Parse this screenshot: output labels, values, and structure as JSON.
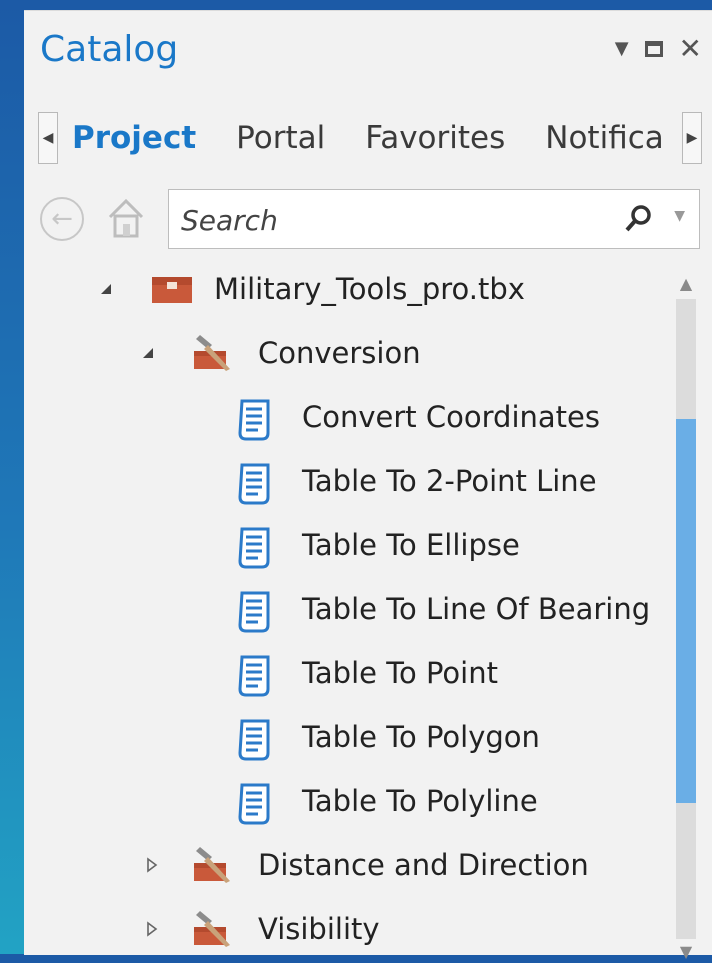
{
  "panel": {
    "title": "Catalog"
  },
  "tabs": [
    {
      "label": "Project",
      "active": true
    },
    {
      "label": "Portal",
      "active": false
    },
    {
      "label": "Favorites",
      "active": false
    },
    {
      "label": "Notifica",
      "active": false
    }
  ],
  "search": {
    "placeholder": "Search"
  },
  "tree": {
    "toolbox": {
      "label": "Military_Tools_pro.tbx",
      "expanded": true
    },
    "toolsets": [
      {
        "label": "Conversion",
        "expanded": true,
        "tools": [
          "Convert Coordinates",
          "Table To 2-Point Line",
          "Table To Ellipse",
          "Table To Line Of Bearing",
          "Table To Point",
          "Table To Polygon",
          "Table To Polyline"
        ]
      },
      {
        "label": "Distance and Direction",
        "expanded": false
      },
      {
        "label": "Visibility",
        "expanded": false
      }
    ]
  },
  "colors": {
    "accent": "#1a78c8",
    "toolbox_icon": "#c9593a",
    "scroll_thumb": "#6aaee6"
  },
  "icons": {
    "toolbox": "toolbox-icon",
    "toolset": "toolset-icon",
    "tool": "script-tool-icon"
  }
}
